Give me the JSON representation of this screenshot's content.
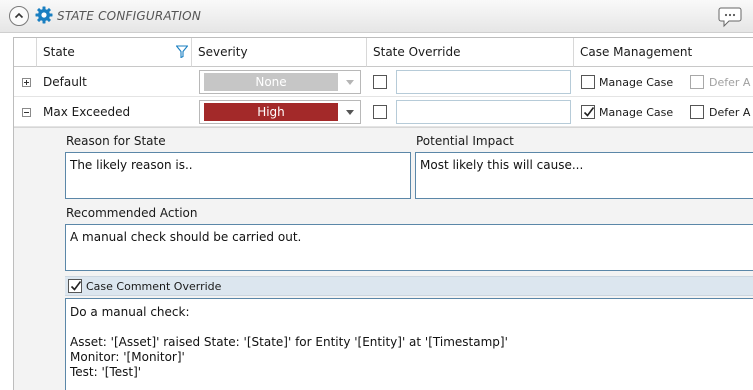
{
  "header": {
    "title": "STATE CONFIGURATION",
    "collapse_icon": "chevron-up-icon",
    "gear_icon": "gear-icon",
    "comment_icon": "speech-bubble-icon",
    "accent": "#1a7fc1"
  },
  "columns": {
    "state": "State",
    "severity": "Severity",
    "state_override": "State Override",
    "case_management": "Case Management"
  },
  "rows": [
    {
      "state": "Default",
      "expanded": false,
      "severity": "None",
      "severity_color": "#c6c6c6",
      "override_checked": false,
      "override_value": "",
      "manage_case_label": "Manage Case",
      "manage_case_checked": false,
      "defer_label": "Defer A"
    },
    {
      "state": "Max Exceeded",
      "expanded": true,
      "severity": "High",
      "severity_color": "#a32929",
      "override_checked": false,
      "override_value": "",
      "manage_case_label": "Manage Case",
      "manage_case_checked": true,
      "defer_label": "Defer A"
    }
  ],
  "detail": {
    "reason_label": "Reason for State",
    "reason_value": "The likely reason is..",
    "impact_label": "Potential Impact",
    "impact_value": "Most likely this will cause...",
    "action_label": "Recommended Action",
    "action_value": "A manual check should be carried out.",
    "case_comment_override_label": "Case Comment Override",
    "case_comment_override_checked": true,
    "case_comment_value": "Do a manual check:\n\nAsset: '[Asset]' raised State: '[State]' for Entity '[Entity]' at '[Timestamp]'\nMonitor: '[Monitor]'\nTest: '[Test]'"
  }
}
